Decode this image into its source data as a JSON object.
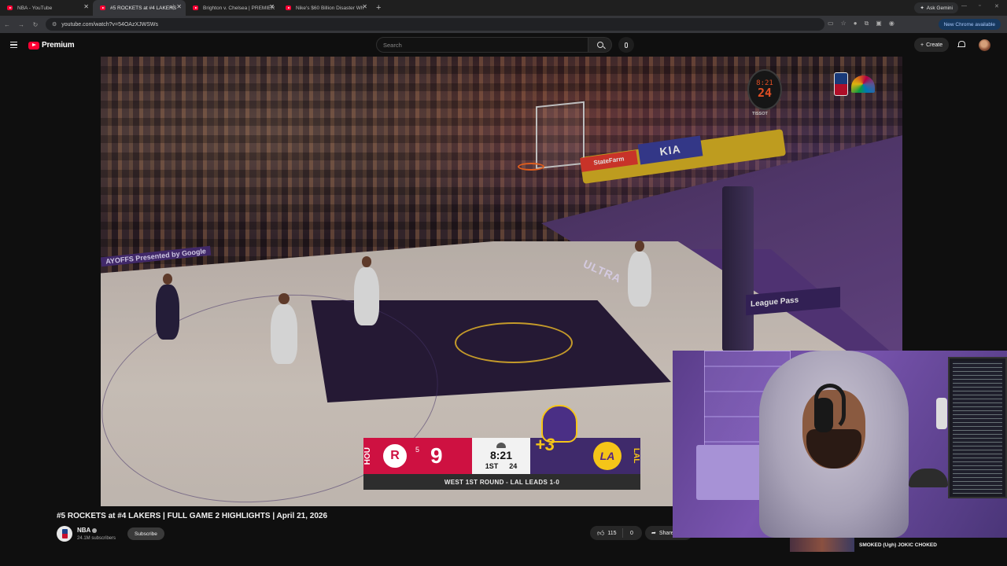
{
  "browser": {
    "tabs": [
      {
        "title": "NBA - YouTube",
        "active": false
      },
      {
        "title": "#5 ROCKETS at #4 LAKERS",
        "active": true
      },
      {
        "title": "Brighton v. Chelsea | PREMIER",
        "active": false
      },
      {
        "title": "Nike's $60 Billion Disaster Wh",
        "active": false
      }
    ],
    "new_tab": "+",
    "ask_gemini": "Ask Gemini",
    "url": "youtube.com/watch?v=54OAzXJWSWs",
    "update_label": "New Chrome available"
  },
  "youtube": {
    "brand": "Premium",
    "search_placeholder": "Search",
    "create_label": "Create"
  },
  "video": {
    "overlay": {
      "shot_clock_time": "8:21",
      "shot_clock_seconds": "24",
      "sponsor": "TISSOT",
      "kia": "KIA",
      "state_farm": "StateFarm",
      "league_pass": "League Pass",
      "ultra": "ULTRA",
      "presented_by": "AYOFFS Presented by Google"
    },
    "scorebug": {
      "away_abbr": "HOU",
      "away_seed": "5",
      "away_score": "9",
      "home_abbr": "LAL",
      "home_logo": "LA",
      "game_clock": "8:21",
      "quarter": "1ST",
      "shot_clock": "24",
      "bonus": "+3",
      "series": "WEST 1ST ROUND - LAL LEADS 1-0"
    }
  },
  "meta": {
    "title": "#5 ROCKETS at #4 LAKERS | FULL GAME 2 HIGHLIGHTS | April 21, 2026",
    "channel": "NBA",
    "subscribers": "24.1M subscribers",
    "subscribe_label": "Subscribe",
    "likes": "115",
    "dislikes": "0",
    "share_label": "Share"
  },
  "recommendation": {
    "title": "SMOKED (Ugh) JOKIC CHOKED"
  },
  "colors": {
    "background": "#0f0f0f",
    "youtube_red": "#ff0033",
    "rockets_red": "#ce1141",
    "lakers_purple": "#3f2a6b",
    "lakers_gold": "#f5c518"
  }
}
